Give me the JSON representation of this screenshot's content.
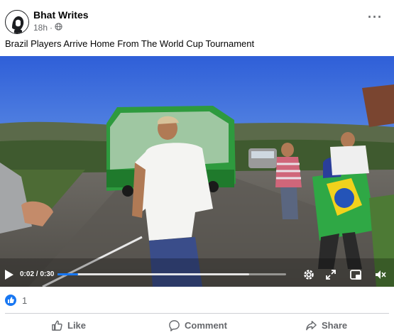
{
  "post": {
    "author": "Bhat Writes",
    "time": "18h",
    "separator": "·",
    "audience_icon": "globe-icon",
    "more_icon": "more-options-icon",
    "more_label": "···",
    "caption": "Brazil Players Arrive Home From The World Cup Tournament"
  },
  "video": {
    "time_display": "0:02 / 0:30",
    "progress": 0.09,
    "buffered": 0.84,
    "icons": [
      "play-icon",
      "settings-icon",
      "fullscreen-icon",
      "picture-in-picture-icon",
      "mute-icon"
    ]
  },
  "reactions": {
    "icon": "like-reaction-icon",
    "count": "1",
    "color": "#1877f2"
  },
  "actions": {
    "like": "Like",
    "comment": "Comment",
    "share": "Share"
  }
}
